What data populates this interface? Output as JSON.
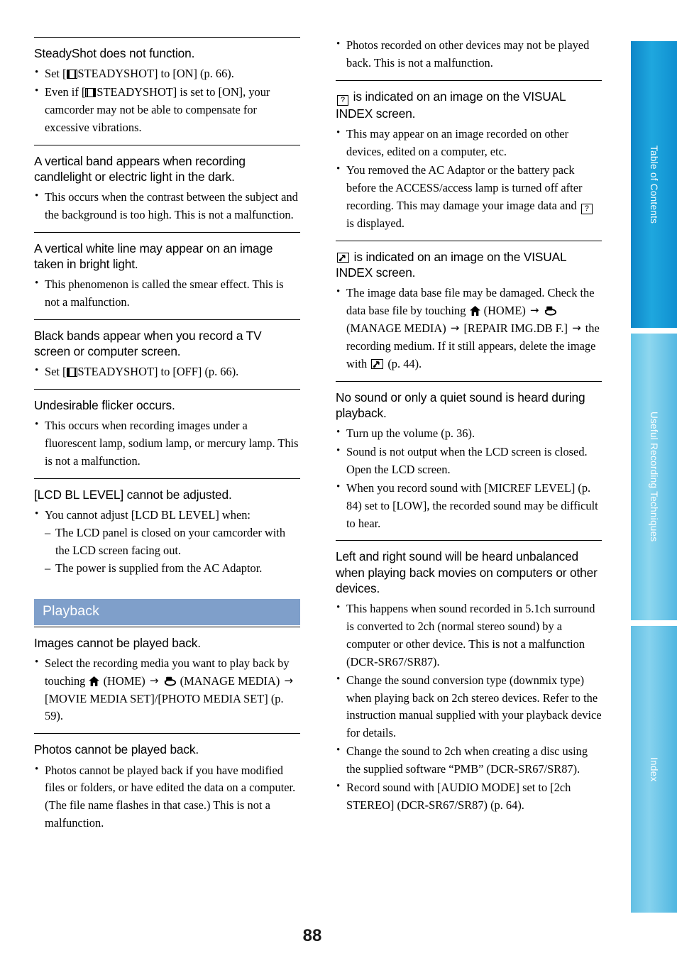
{
  "page": {
    "number": "88",
    "colors": {
      "section_bar": "#7f9fca",
      "tab_active": "#1fa7de",
      "tab_inactive": "#86d2ee"
    }
  },
  "tabs": [
    {
      "label": "Table of Contents"
    },
    {
      "label": "Useful Recording Techniques"
    },
    {
      "label": "Index"
    }
  ],
  "left_column": {
    "topics": [
      {
        "title": "SteadyShot does not function.",
        "bullets": [
          {
            "parts": [
              {
                "t": "Set ["
              },
              {
                "icon": "film-icon"
              },
              {
                "t": "STEADYSHOT] to [ON] (p. 66)."
              }
            ]
          },
          {
            "parts": [
              {
                "t": "Even if ["
              },
              {
                "icon": "film-icon"
              },
              {
                "t": "STEADYSHOT] is set to [ON], your camcorder may not be able to compensate for excessive vibrations."
              }
            ]
          }
        ]
      },
      {
        "title": "A vertical band appears when recording candlelight or electric light in the dark.",
        "bullets": [
          {
            "parts": [
              {
                "t": "This occurs when the contrast between the subject and the background is too high. This is not a malfunction."
              }
            ]
          }
        ]
      },
      {
        "title": "A vertical white line may appear on an image taken in bright light.",
        "bullets": [
          {
            "parts": [
              {
                "t": "This phenomenon is called the smear effect. This is not a malfunction."
              }
            ]
          }
        ]
      },
      {
        "title": "Black bands appear when you record a TV screen or computer screen.",
        "bullets": [
          {
            "parts": [
              {
                "t": "Set ["
              },
              {
                "icon": "film-icon"
              },
              {
                "t": "STEADYSHOT] to [OFF] (p. 66)."
              }
            ]
          }
        ]
      },
      {
        "title": "Undesirable flicker occurs.",
        "bullets": [
          {
            "parts": [
              {
                "t": "This occurs when recording images under a fluorescent lamp, sodium lamp, or mercury lamp. This is not a malfunction."
              }
            ]
          }
        ]
      },
      {
        "title": "[LCD BL LEVEL] cannot be adjusted.",
        "bullets": [
          {
            "parts": [
              {
                "t": "You cannot adjust [LCD BL LEVEL] when:"
              }
            ],
            "sub": [
              "The LCD panel is closed on your camcorder with the LCD screen facing out.",
              "The power is supplied from the AC Adaptor."
            ]
          }
        ]
      }
    ],
    "section_bar": "Playback",
    "topics_after_bar": [
      {
        "title": "Images cannot be played back.",
        "bullets": [
          {
            "parts": [
              {
                "t": "Select the recording media you want to play back by touching "
              },
              {
                "icon": "home-icon"
              },
              {
                "t": " (HOME) "
              },
              {
                "icon": "arrow-right"
              },
              {
                "t": " "
              },
              {
                "icon": "manage-media-icon"
              },
              {
                "t": " (MANAGE MEDIA) "
              },
              {
                "icon": "arrow-right"
              },
              {
                "t": " [MOVIE MEDIA SET]/[PHOTO MEDIA SET] (p. 59)."
              }
            ]
          }
        ]
      },
      {
        "title": "Photos cannot be played back.",
        "bullets": [
          {
            "parts": [
              {
                "t": "Photos cannot be played back if you have modified files or folders, or have edited the data on a computer. (The file name flashes in that case.) This is not a malfunction."
              }
            ]
          }
        ]
      }
    ]
  },
  "right_column": {
    "lead_bullets": [
      {
        "parts": [
          {
            "t": "Photos recorded on other devices may not be played back. This is not a malfunction."
          }
        ]
      }
    ],
    "topics": [
      {
        "title_parts": [
          {
            "icon": "question-box-icon"
          },
          {
            "t": " is indicated on an image on the VISUAL INDEX screen."
          }
        ],
        "bullets": [
          {
            "parts": [
              {
                "t": "This may appear on an image recorded on other devices, edited on a computer, etc."
              }
            ]
          },
          {
            "parts": [
              {
                "t": "You removed the AC Adaptor or the battery pack before the ACCESS/access lamp is turned off after recording. This may damage your image data and "
              },
              {
                "icon": "question-box-icon"
              },
              {
                "t": " is displayed."
              }
            ]
          }
        ]
      },
      {
        "title_parts": [
          {
            "icon": "broken-image-icon"
          },
          {
            "t": " is indicated on an image on the VISUAL INDEX screen."
          }
        ],
        "bullets": [
          {
            "parts": [
              {
                "t": "The image data base file may be damaged. Check the data base file by touching "
              },
              {
                "icon": "home-icon"
              },
              {
                "t": " (HOME) "
              },
              {
                "icon": "arrow-right"
              },
              {
                "t": " "
              },
              {
                "icon": "manage-media-icon"
              },
              {
                "t": " (MANAGE MEDIA) "
              },
              {
                "icon": "arrow-right"
              },
              {
                "t": " [REPAIR IMG.DB F.] "
              },
              {
                "icon": "arrow-right"
              },
              {
                "t": " the recording medium. If it still appears, delete the image with "
              },
              {
                "icon": "broken-image-icon"
              },
              {
                "t": " (p. 44)."
              }
            ]
          }
        ]
      },
      {
        "title": "No sound or only a quiet sound is heard during playback.",
        "bullets": [
          {
            "parts": [
              {
                "t": "Turn up the volume (p. 36)."
              }
            ]
          },
          {
            "parts": [
              {
                "t": "Sound is not output when the LCD screen is closed. Open the LCD screen."
              }
            ]
          },
          {
            "parts": [
              {
                "t": "When you record sound with [MICREF LEVEL] (p. 84) set to [LOW], the recorded sound may be difficult to hear."
              }
            ]
          }
        ]
      },
      {
        "title": "Left and right sound will be heard unbalanced when playing back movies on computers or other devices.",
        "bullets": [
          {
            "parts": [
              {
                "t": "This happens when sound recorded in 5.1ch surround is converted to 2ch (normal stereo sound) by a computer or other device. This is not a malfunction (DCR-SR67/SR87)."
              }
            ]
          },
          {
            "parts": [
              {
                "t": "Change the sound conversion type (downmix type) when playing back on 2ch stereo devices. Refer to the instruction manual supplied with your playback device for details."
              }
            ]
          },
          {
            "parts": [
              {
                "t": "Change the sound to 2ch when creating a disc using the supplied software “PMB” (DCR-SR67/SR87)."
              }
            ]
          },
          {
            "parts": [
              {
                "t": "Record sound with [AUDIO MODE] set to [2ch STEREO] (DCR-SR67/SR87) (p. 64)."
              }
            ]
          }
        ]
      }
    ]
  }
}
